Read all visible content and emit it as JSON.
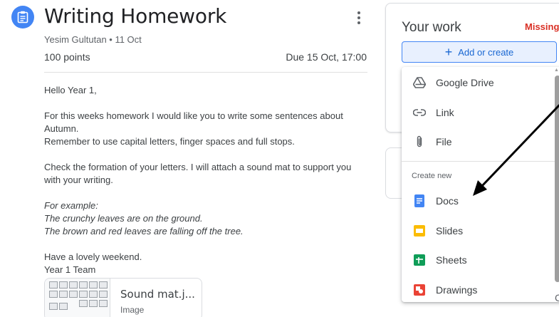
{
  "assignment": {
    "title": "Writing Homework",
    "meta": "Yesim Gultutan • 11 Oct",
    "points": "100 points",
    "due": "Due 15 Oct, 17:00",
    "body": [
      "Hello Year 1,",
      "For this weeks homework I would like you to write some sentences about Autumn.\nRemember to use capital letters, finger spaces and full stops.",
      "Check the formation of your letters. I will attach a sound mat to support you with your writing."
    ],
    "example": "For example:\nThe crunchy leaves are on the ground.\nThe brown and red leaves are falling off the tree.",
    "signoff": "Have a lovely weekend.\nYear 1 Team"
  },
  "attachment": {
    "name": "Sound mat.j...",
    "type": "Image"
  },
  "your_work": {
    "title": "Your work",
    "status": "Missing",
    "add_label": "Add or create"
  },
  "menu": {
    "items": [
      {
        "label": "Google Drive",
        "icon": "google-drive-icon"
      },
      {
        "label": "Link",
        "icon": "link-icon"
      },
      {
        "label": "File",
        "icon": "paperclip-icon"
      }
    ],
    "create_heading": "Create new",
    "create_items": [
      {
        "label": "Docs",
        "icon": "docs-icon",
        "color": "#4285f4"
      },
      {
        "label": "Slides",
        "icon": "slides-icon",
        "color": "#fbbc04"
      },
      {
        "label": "Sheets",
        "icon": "sheets-icon",
        "color": "#0f9d58"
      },
      {
        "label": "Drawings",
        "icon": "drawings-icon",
        "color": "#ea4335"
      }
    ]
  },
  "partial_text": "C",
  "colors": {
    "accent": "#1967d2",
    "missing": "#d93025"
  }
}
